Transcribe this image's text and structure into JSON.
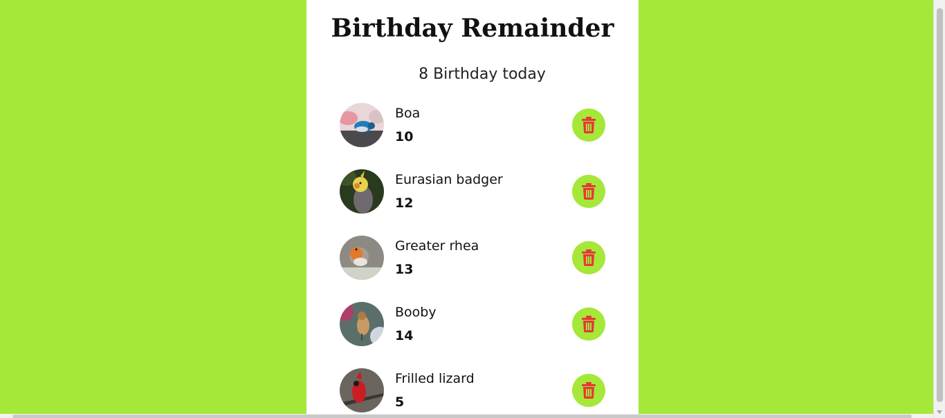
{
  "app": {
    "title": "Birthday Remainder",
    "subtitle": "8 Birthday today"
  },
  "colors": {
    "background": "#a5e83a",
    "card": "#ffffff",
    "delete_button_bg": "#a5e83a",
    "delete_icon": "#e53935"
  },
  "people": [
    {
      "name": "Boa",
      "age": "10",
      "avatar": "blue-bird-photo"
    },
    {
      "name": "Eurasian badger",
      "age": "12",
      "avatar": "cockatiel-photo"
    },
    {
      "name": "Greater rhea",
      "age": "13",
      "avatar": "robin-photo"
    },
    {
      "name": "Booby",
      "age": "14",
      "avatar": "sparrow-photo"
    },
    {
      "name": "Frilled lizard",
      "age": "5",
      "avatar": "cardinal-photo"
    }
  ],
  "icons": {
    "delete": "trash-icon"
  }
}
